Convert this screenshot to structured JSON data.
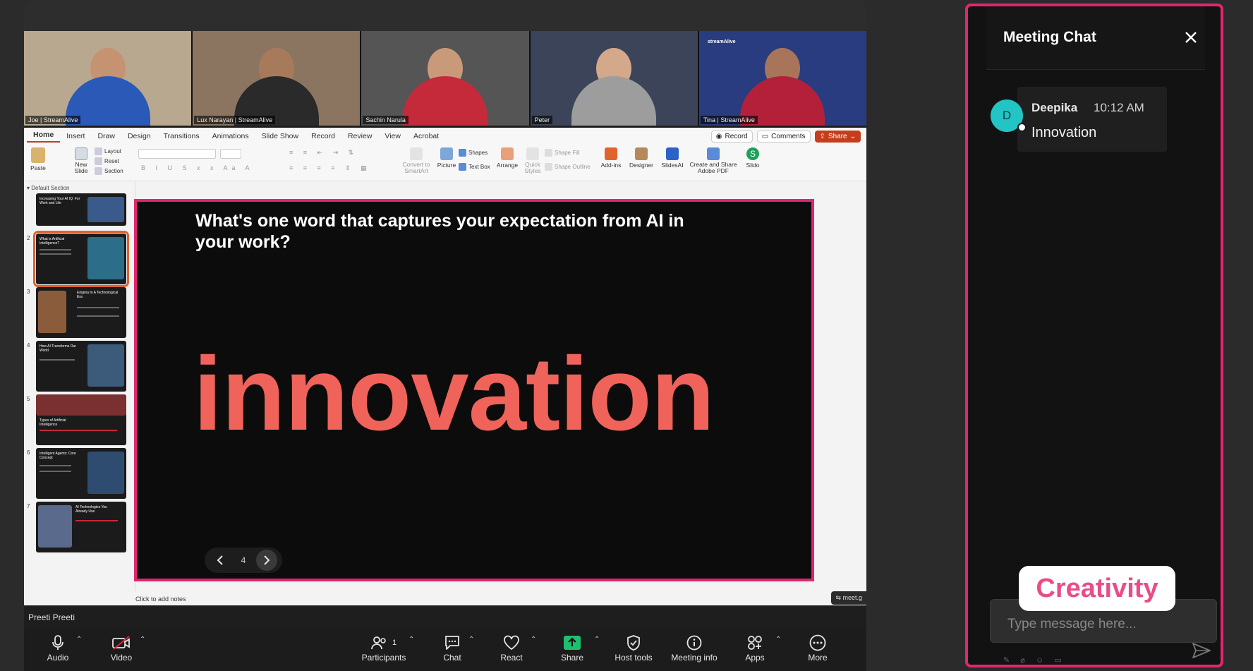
{
  "gallery": {
    "tiles": [
      {
        "name": "Joe | StreamAlive",
        "shirt": "#2a59b8",
        "bg": "#b9a890",
        "brand": ""
      },
      {
        "name": "Lux Narayan | StreamAlive",
        "shirt": "#2a2a2a",
        "bg": "#8c7560",
        "brand": ""
      },
      {
        "name": "Sachin Narula",
        "shirt": "#c42a3a",
        "bg": "#555555",
        "brand": ""
      },
      {
        "name": "Peter",
        "shirt": "#9d9d9d",
        "bg": "#3b4458",
        "brand": ""
      },
      {
        "name": "Tina | StreamAlive",
        "shirt": "#b4203a",
        "bg": "#2a3c80",
        "brand": "streamAlive"
      }
    ]
  },
  "ppt": {
    "tabs": [
      "Home",
      "Insert",
      "Draw",
      "Design",
      "Transitions",
      "Animations",
      "Slide Show",
      "Record",
      "Review",
      "View",
      "Acrobat"
    ],
    "record_label": "Record",
    "comments_label": "Comments",
    "share_label": "Share",
    "ribbon": {
      "paste": "Paste",
      "new_slide": "New Slide",
      "layout": "Layout",
      "reset": "Reset",
      "section": "Section",
      "convert": "Convert to SmartArt",
      "picture": "Picture",
      "shapes": "Shapes",
      "text_box": "Text Box",
      "arrange": "Arrange",
      "quick_styles": "Quick Styles",
      "shape_fill": "Shape Fill",
      "shape_outline": "Shape Outline",
      "addins": "Add-ins",
      "designer": "Designer",
      "slidesai": "SlidesAI",
      "adobe": "Create and Share Adobe PDF",
      "slido": "Slido"
    },
    "section_label": "Default Section",
    "thumbs": [
      {
        "num": "",
        "title": "Increasing Your AI IQ: For Work and Life",
        "img": "#3a5a8c"
      },
      {
        "num": "2",
        "title": "What is Artificial Intelligence?",
        "img": "#2c6e8a"
      },
      {
        "num": "3",
        "title": "Enigma to A Technological Era",
        "img": "#8a5c3c"
      },
      {
        "num": "4",
        "title": "How AI Transforms Our World",
        "img": "#3c5a7a"
      },
      {
        "num": "5",
        "title": "Types of Artificial Intelligence",
        "img": "#7a3030"
      },
      {
        "num": "6",
        "title": "Intelligent Agents: Core Concept",
        "img": "#2e4c70"
      },
      {
        "num": "7",
        "title": "AI Technologies You Already Use",
        "img": "#5a6a8c"
      }
    ],
    "slide": {
      "question": "What's one word that captures your expectation from AI in your work?",
      "word": "innovation",
      "page": "4"
    },
    "notes_placeholder": "Click to add notes",
    "meet_chip": "meet.g"
  },
  "zoom": {
    "presenter": "Preeti Preeti",
    "controls": {
      "audio": "Audio",
      "video": "Video",
      "participants": "Participants",
      "participants_count": "1",
      "chat": "Chat",
      "react": "React",
      "share": "Share",
      "host_tools": "Host tools",
      "meeting_info": "Meeting info",
      "apps": "Apps",
      "more": "More"
    }
  },
  "chat": {
    "title": "Meeting Chat",
    "message": {
      "avatar_letter": "D",
      "sender": "Deepika",
      "time": "10:12 AM",
      "text": "Innovation"
    },
    "floating_tag": "Creativity",
    "input_placeholder": "Type message here..."
  },
  "colors": {
    "highlight": "#e0266f",
    "slide_word": "#f0635a",
    "avatar": "#22c4c4",
    "share_green": "#1ec070"
  }
}
